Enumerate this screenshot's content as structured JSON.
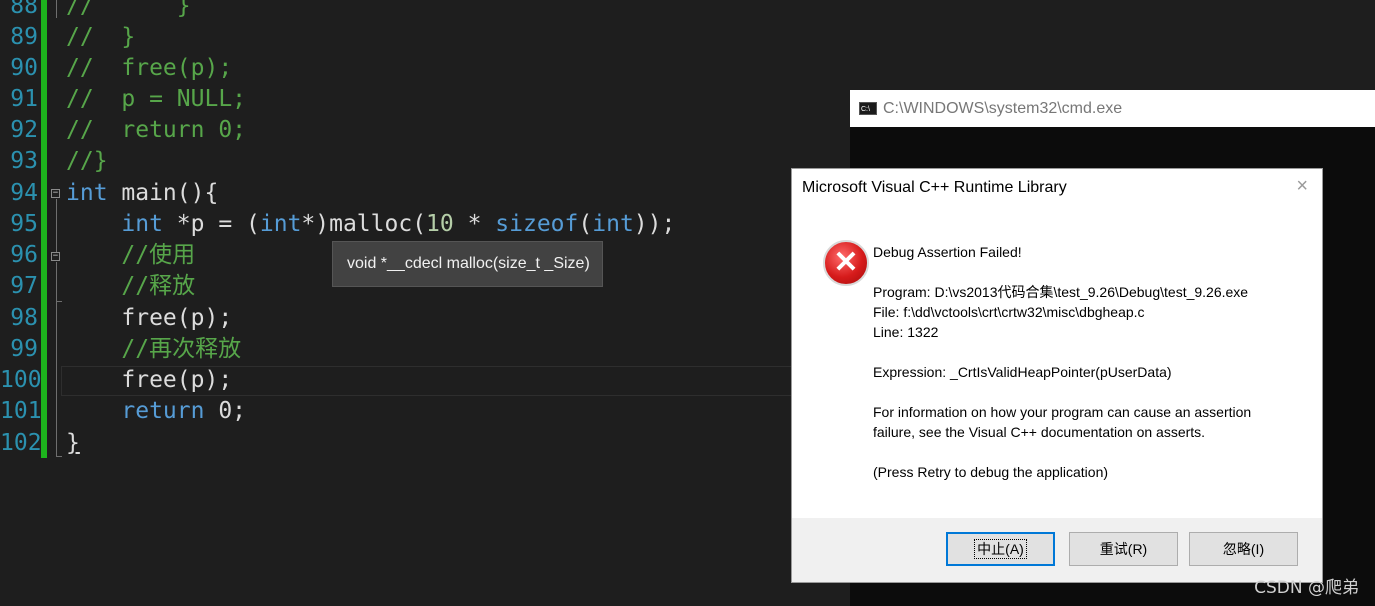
{
  "editor": {
    "lines": [
      {
        "num": "88",
        "text": "//      }"
      },
      {
        "num": "89",
        "text": "//  }"
      },
      {
        "num": "90",
        "text": "//  free(p);"
      },
      {
        "num": "91",
        "text": "//  p = NULL;"
      },
      {
        "num": "92",
        "text": "//  return 0;"
      },
      {
        "num": "93",
        "text": "//}"
      },
      {
        "num": "94",
        "kw": "int",
        "rest": " main(){"
      },
      {
        "num": "95",
        "indent": "    ",
        "kw1": "int",
        "p1": " *p = (",
        "kw2": "int",
        "p2": "*)malloc(",
        "n1": "10",
        "p3": " * ",
        "kw3": "sizeof",
        "p4": "(",
        "kw4": "int",
        "p5": "));"
      },
      {
        "num": "96",
        "comment": "    //使用"
      },
      {
        "num": "97",
        "comment": "    //释放"
      },
      {
        "num": "98",
        "text": "    free(p);"
      },
      {
        "num": "99",
        "comment": "    //再次释放"
      },
      {
        "num": "100",
        "text": "    free(p);"
      },
      {
        "num": "101",
        "kw": "return",
        "rest": " 0;",
        "indent": "    "
      },
      {
        "num": "102",
        "text": "}"
      }
    ],
    "tooltip": "void *__cdecl malloc(size_t _Size)"
  },
  "console": {
    "title": "C:\\WINDOWS\\system32\\cmd.exe",
    "icon": "cmd-icon"
  },
  "dialog": {
    "title": "Microsoft Visual C++ Runtime Library",
    "close": "×",
    "icon": "error-icon",
    "heading": "Debug Assertion Failed!",
    "program": "Program: D:\\vs2013代码合集\\test_9.26\\Debug\\test_9.26.exe",
    "file": "File: f:\\dd\\vctools\\crt\\crtw32\\misc\\dbgheap.c",
    "line": "Line: 1322",
    "expression": "Expression: _CrtIsValidHeapPointer(pUserData)",
    "info1": "For information on how your program can cause an assertion",
    "info2": "failure, see the Visual C++ documentation on asserts.",
    "press": "(Press Retry to debug the application)",
    "buttons": {
      "abort": "中止(A)",
      "retry": "重试(R)",
      "ignore": "忽略(I)"
    }
  },
  "watermark": "CSDN @爬弟"
}
